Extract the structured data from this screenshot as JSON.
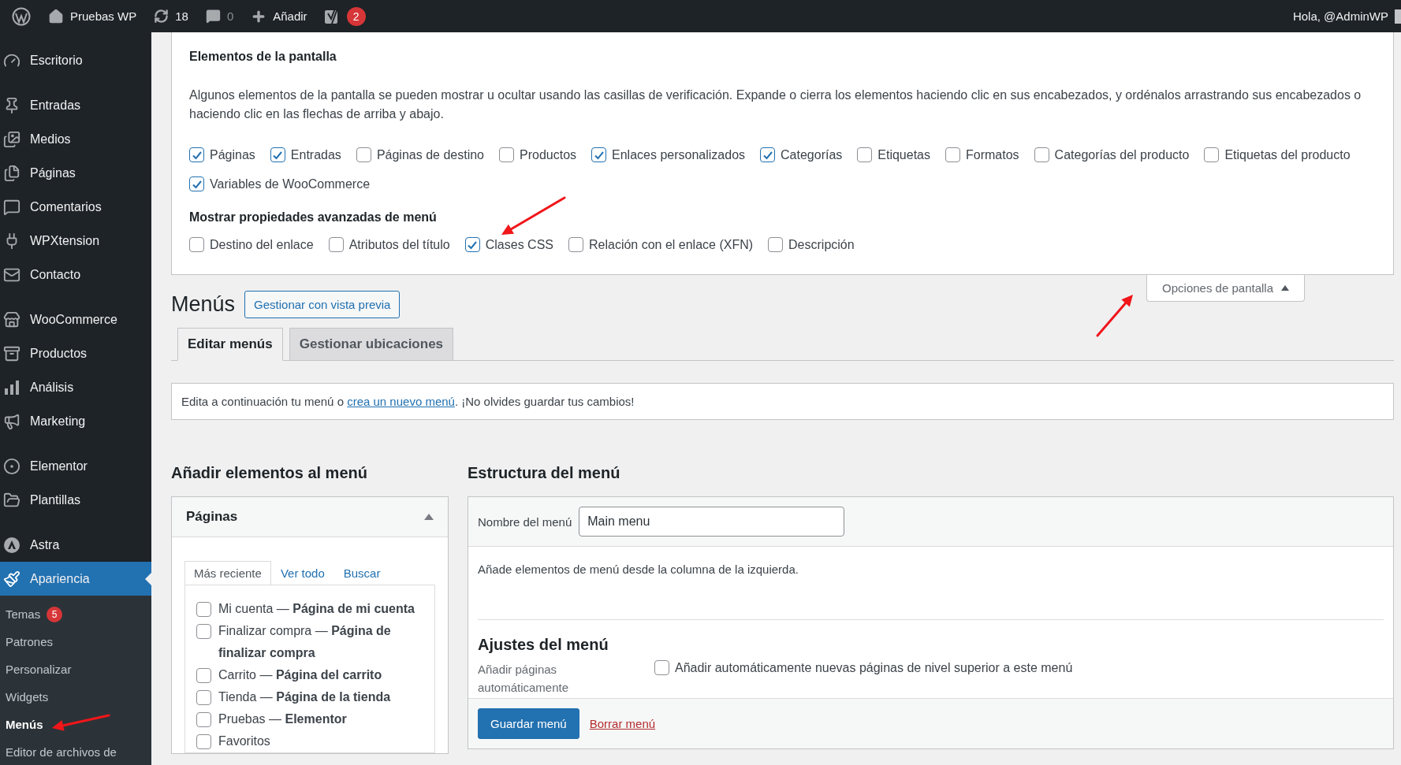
{
  "admin_bar": {
    "site": "Pruebas WP",
    "updates": "18",
    "comments": "0",
    "new": "Añadir",
    "seo_badge": "2",
    "greeting": "Hola, @AdminWP"
  },
  "sidebar": {
    "groups": [
      [
        {
          "label": "Escritorio",
          "selected": false
        }
      ],
      [
        {
          "label": "Entradas",
          "selected": false
        },
        {
          "label": "Medios",
          "selected": false
        },
        {
          "label": "Páginas",
          "selected": false
        },
        {
          "label": "Comentarios",
          "selected": false
        },
        {
          "label": "WPXtension",
          "selected": false
        },
        {
          "label": "Contacto",
          "selected": false
        }
      ],
      [
        {
          "label": "WooCommerce",
          "selected": false
        },
        {
          "label": "Productos",
          "selected": false
        },
        {
          "label": "Análisis",
          "selected": false
        },
        {
          "label": "Marketing",
          "selected": false
        }
      ],
      [
        {
          "label": "Elementor",
          "selected": false
        },
        {
          "label": "Plantillas",
          "selected": false
        }
      ],
      [
        {
          "label": "Astra",
          "selected": false
        },
        {
          "label": "Apariencia",
          "selected": true
        }
      ]
    ],
    "submenu": [
      {
        "label": "Temas",
        "badge": "5",
        "selected": false
      },
      {
        "label": "Patrones",
        "selected": false
      },
      {
        "label": "Personalizar",
        "selected": false
      },
      {
        "label": "Widgets",
        "selected": false
      },
      {
        "label": "Menús",
        "selected": true
      },
      {
        "label": "Editor de archivos de",
        "selected": false
      }
    ]
  },
  "screen_options": {
    "heading": "Elementos de la pantalla",
    "description": "Algunos elementos de la pantalla se pueden mostrar u ocultar usando las casillas de verificación. Expande o cierra los elementos haciendo clic en sus encabezados, y ordénalos arrastrando sus encabezados o haciendo clic en las flechas de arriba y abajo.",
    "boxes": [
      {
        "label": "Páginas",
        "checked": true
      },
      {
        "label": "Entradas",
        "checked": true
      },
      {
        "label": "Páginas de destino",
        "checked": false
      },
      {
        "label": "Productos",
        "checked": false
      },
      {
        "label": "Enlaces personalizados",
        "checked": true
      },
      {
        "label": "Categorías",
        "checked": true
      },
      {
        "label": "Etiquetas",
        "checked": false
      },
      {
        "label": "Formatos",
        "checked": false
      },
      {
        "label": "Categorías del producto",
        "checked": false
      },
      {
        "label": "Etiquetas del producto",
        "checked": false
      },
      {
        "label": "Variables de WooCommerce",
        "checked": true
      }
    ],
    "advanced_heading": "Mostrar propiedades avanzadas de menú",
    "advanced": [
      {
        "label": "Destino del enlace",
        "checked": false
      },
      {
        "label": "Atributos del título",
        "checked": false
      },
      {
        "label": "Clases CSS",
        "checked": true
      },
      {
        "label": "Relación con el enlace (XFN)",
        "checked": false
      },
      {
        "label": "Descripción",
        "checked": false
      }
    ],
    "toggle": "Opciones de pantalla",
    "expanded": true
  },
  "title": "Menús",
  "preview_button": "Gestionar con vista previa",
  "tabs": [
    {
      "label": "Editar menús",
      "selected": true
    },
    {
      "label": "Gestionar ubicaciones",
      "selected": false
    }
  ],
  "notice": {
    "before": "Edita a continuación tu menú o",
    "link": "crea un nuevo menú",
    "after": ". ¡No olvides guardar tus cambios!"
  },
  "add_items": {
    "heading": "Añadir elementos al menú",
    "box_title": "Páginas",
    "expanded": true,
    "tabs": [
      {
        "label": "Más reciente",
        "selected": true
      },
      {
        "label": "Ver todo",
        "selected": false
      },
      {
        "label": "Buscar",
        "selected": false
      }
    ],
    "items": [
      {
        "label": "Mi cuenta — **Página de mi cuenta**",
        "checked": false
      },
      {
        "label": "Finalizar compra — **Página de finalizar compra**",
        "checked": false
      },
      {
        "label": "Carrito — **Página del carrito**",
        "checked": false
      },
      {
        "label": "Tienda — **Página de la tienda**",
        "checked": false
      },
      {
        "label": "Pruebas — **Elementor**",
        "checked": false
      },
      {
        "label": "Favoritos",
        "checked": false
      }
    ]
  },
  "structure": {
    "heading": "Estructura del menú",
    "name_label": "Nombre del menú",
    "name_value": "Main menu",
    "hint": "Añade elementos de menú desde la columna de la izquierda.",
    "settings_heading": "Ajustes del menú",
    "auto_label": "Añadir páginas automáticamente",
    "auto_option": {
      "label": "Añadir automáticamente nuevas páginas de nivel superior a este menú",
      "checked": false
    },
    "save": "Guardar menú",
    "delete": "Borrar menú"
  }
}
